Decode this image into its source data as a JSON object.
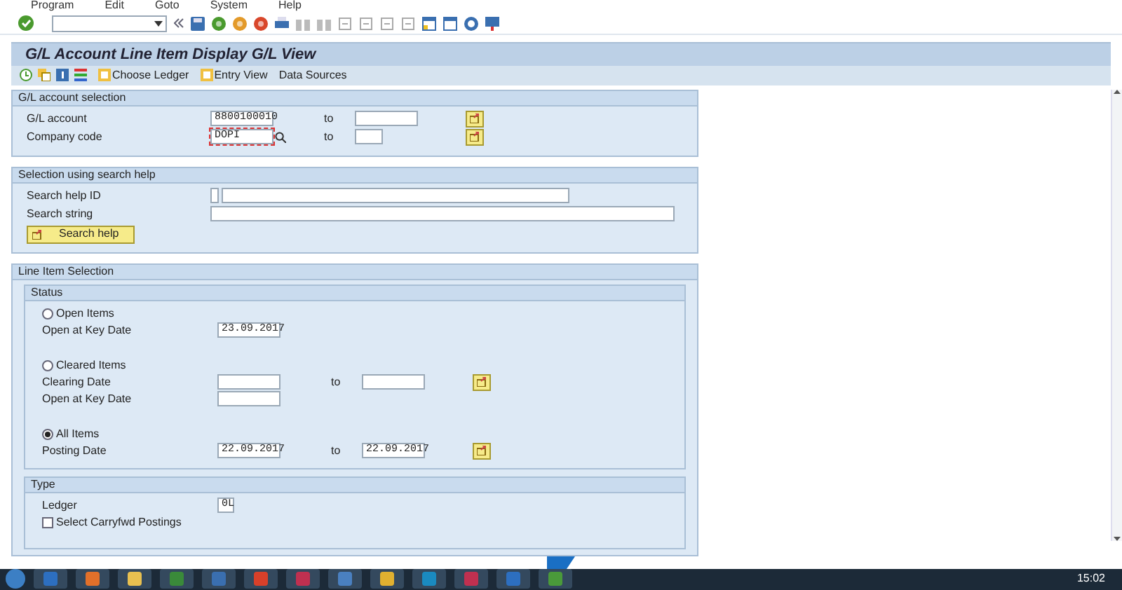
{
  "menu": [
    "Program",
    "Edit",
    "Goto",
    "System",
    "Help"
  ],
  "title": "G/L Account Line Item Display G/L View",
  "app_toolbar": [
    {
      "label": "Choose Ledger"
    },
    {
      "label": "Entry View"
    },
    {
      "label": "Data Sources"
    }
  ],
  "gl_selection": {
    "title": "G/L account selection",
    "rows": [
      {
        "label": "G/L account",
        "from": "8800100010",
        "focused": false,
        "to_label": "to",
        "short": false
      },
      {
        "label": "Company code",
        "from": "DOPI",
        "focused": true,
        "to_label": "to",
        "short": true
      }
    ]
  },
  "search_help": {
    "title": "Selection using search help",
    "id_label": "Search help ID",
    "string_label": "Search string",
    "button": "Search help"
  },
  "line_items": {
    "title": "Line Item Selection",
    "status": {
      "title": "Status",
      "options": [
        {
          "label": "Open Items",
          "selected": false,
          "fields": [
            {
              "label": "Open at Key Date",
              "from": "23.09.2017"
            }
          ]
        },
        {
          "label": "Cleared Items",
          "selected": false,
          "fields": [
            {
              "label": "Clearing Date",
              "to_label": "to"
            },
            {
              "label": "Open at Key Date"
            }
          ]
        },
        {
          "label": "All Items",
          "selected": true,
          "fields": [
            {
              "label": "Posting Date",
              "from": "22.09.2017",
              "to_label": "to",
              "to": "22.09.2017"
            }
          ]
        }
      ]
    },
    "type": {
      "title": "Type",
      "ledger_label": "Ledger",
      "ledger": "0L",
      "carryfwd": {
        "label": "Select Carryfwd Postings",
        "checked": false
      }
    }
  },
  "taskbar": {
    "clock": "15:02"
  }
}
